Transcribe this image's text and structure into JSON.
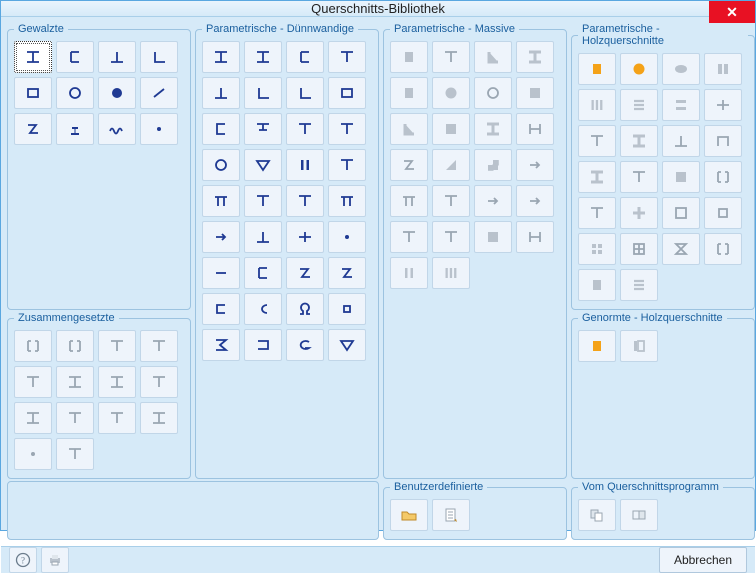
{
  "window": {
    "title": "Querschnitts-Bibliothek"
  },
  "groups": {
    "gewalzte": "Gewalzte",
    "zusammengesetzte": "Zusammengesetzte",
    "param_duenn": "Parametrische - Dünnwandige",
    "param_massiv": "Parametrische - Massive",
    "param_holz": "Parametrische - Holzquerschnitte",
    "genormte_holz": "Genormte - Holzquerschnitte",
    "benutzer": "Benutzerdefinierte",
    "programm": "Vom Querschnittsprogramm"
  },
  "buttons": {
    "cancel": "Abbrechen"
  },
  "colors": {
    "stroke_blue": "#1f3a93",
    "stroke_grey": "#9aa6b2",
    "fill_orange": "#f4a218",
    "fill_grey": "#b9c2cc"
  },
  "icons": {
    "gewalzte": [
      [
        "i-beam",
        "channel-left",
        "tee-down",
        "angle"
      ],
      [
        "rect-tube",
        "round-tube",
        "round-bar",
        "angle-open"
      ],
      [
        "z-section",
        "rail",
        "corrugated",
        "point-symbol"
      ]
    ],
    "zusammengesetzte": [
      [
        "double-i",
        "double-i-join",
        "tee-over-i",
        "tee-pair"
      ],
      [
        "tee-pair-down",
        "i-pair",
        "i-flip",
        "tee-stack"
      ],
      [
        "i-bracket",
        "tee-bracket",
        "tee-mirror",
        "i-boxed"
      ],
      [
        "dots",
        "tee-single",
        "",
        ""
      ]
    ],
    "param_duenn": [
      [
        "i-beam",
        "i-beam-wide",
        "channel",
        "tee"
      ],
      [
        "tee-down",
        "angle",
        "angle-L",
        "rect-tube"
      ],
      [
        "channel-r",
        "i-stub",
        "tee-top",
        "tee-flip"
      ],
      [
        "circle",
        "down-tri",
        "double-bar",
        "double-tee"
      ],
      [
        "pi",
        "double-tee-2",
        "tee-wide",
        "double-pi"
      ],
      [
        "i-narrow",
        "tee-down-2",
        "plus",
        "dot"
      ],
      [
        "minus",
        "channel-open",
        "z-left",
        "z-right"
      ],
      [
        "c-open",
        "subset",
        "omega",
        "rect-small"
      ],
      [
        "sigma",
        "open-rect",
        "g-shape",
        "down-tri-2"
      ]
    ],
    "param_massiv": [
      [
        "rect-solid",
        "tee-solid",
        "l-solid",
        "i-solid"
      ],
      [
        "square",
        "circle-solid",
        "half-circle",
        "u-solid"
      ],
      [
        "l-fill",
        "u-fill",
        "i-fill",
        "h-fill"
      ],
      [
        "z-fill",
        "tri-90",
        "step",
        "arrow"
      ],
      [
        "pi-fill",
        "tee-fill",
        "h-narrow",
        "u-narrow"
      ],
      [
        "tee-small",
        "tee-pair-fill",
        "u-small",
        "h-small"
      ],
      [
        "bars-2",
        "bars-3",
        "",
        ""
      ]
    ],
    "param_holz": [
      [
        "rect-solid",
        "circle-solid",
        "ellipse",
        "double-rect"
      ],
      [
        "triple-bar",
        "dash-stack",
        "h-bars",
        "plus-thick"
      ],
      [
        "tee-wood",
        "i-wood",
        "tee-down-wood",
        "cap-wood"
      ],
      [
        "i-thin",
        "tee-thin",
        "u-thin",
        "double-i-wood"
      ],
      [
        "tee-flip-wood",
        "cross-wood",
        "box-wood",
        "double-box"
      ],
      [
        "grid4",
        "grid-diag",
        "hourglass",
        "double-i-alt"
      ],
      [
        "square-small",
        "menu-bars",
        "",
        ""
      ]
    ],
    "genormte_holz": [
      [
        "rect-solid",
        "i-rect"
      ]
    ],
    "benutzer": [
      "folder",
      "document"
    ],
    "programm": [
      "duplicate",
      "link-shape"
    ],
    "bottom": [
      "help",
      "print"
    ]
  }
}
